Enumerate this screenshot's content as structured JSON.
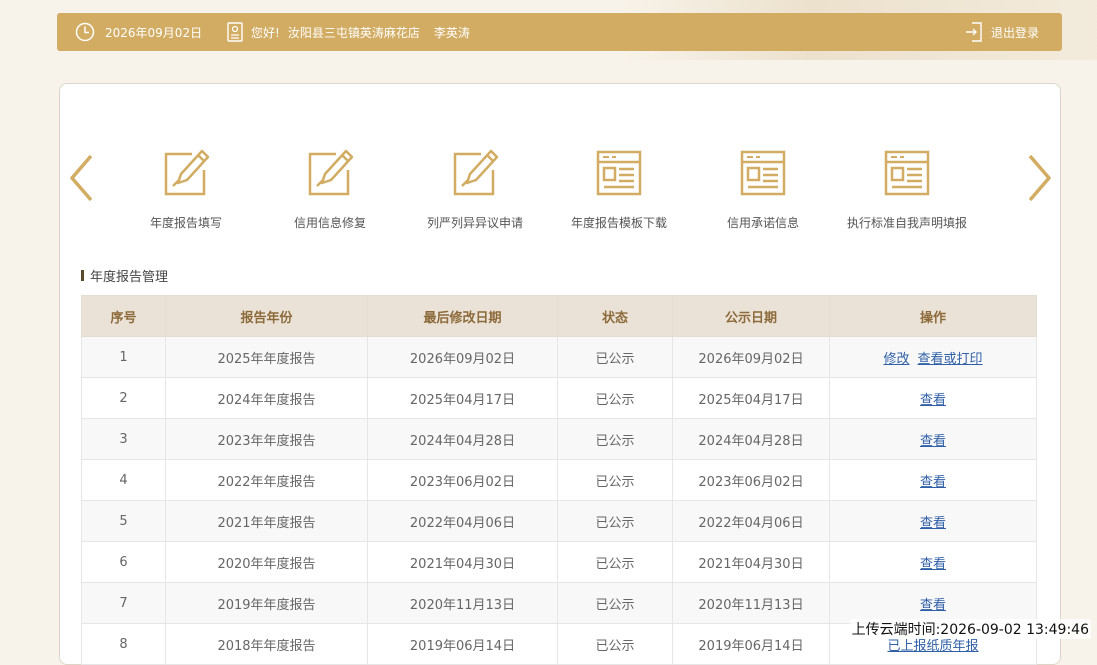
{
  "topbar": {
    "date": "2026年09月02日",
    "greeting": "您好!",
    "shop": "汝阳县三屯镇英涛麻花店",
    "person": "李英涛",
    "logout": "退出登录"
  },
  "services": [
    {
      "label": "年度报告填写",
      "icon": "edit-icon"
    },
    {
      "label": "信用信息修复",
      "icon": "edit-icon"
    },
    {
      "label": "列严列异异议申请",
      "icon": "edit-icon"
    },
    {
      "label": "年度报告模板下载",
      "icon": "document-icon"
    },
    {
      "label": "信用承诺信息",
      "icon": "document-icon"
    },
    {
      "label": "执行标准自我声明填报",
      "icon": "document-icon"
    }
  ],
  "section_title": "年度报告管理",
  "table": {
    "headers": [
      "序号",
      "报告年份",
      "最后修改日期",
      "状态",
      "公示日期",
      "操作"
    ],
    "rows": [
      {
        "no": "1",
        "year": "2025年年度报告",
        "modified": "2026年09月02日",
        "status": "已公示",
        "published": "2026年09月02日",
        "actions": [
          "修改",
          "查看或打印"
        ]
      },
      {
        "no": "2",
        "year": "2024年年度报告",
        "modified": "2025年04月17日",
        "status": "已公示",
        "published": "2025年04月17日",
        "actions": [
          "查看"
        ]
      },
      {
        "no": "3",
        "year": "2023年年度报告",
        "modified": "2024年04月28日",
        "status": "已公示",
        "published": "2024年04月28日",
        "actions": [
          "查看"
        ]
      },
      {
        "no": "4",
        "year": "2022年年度报告",
        "modified": "2023年06月02日",
        "status": "已公示",
        "published": "2023年06月02日",
        "actions": [
          "查看"
        ]
      },
      {
        "no": "5",
        "year": "2021年年度报告",
        "modified": "2022年04月06日",
        "status": "已公示",
        "published": "2022年04月06日",
        "actions": [
          "查看"
        ]
      },
      {
        "no": "6",
        "year": "2020年年度报告",
        "modified": "2021年04月30日",
        "status": "已公示",
        "published": "2021年04月30日",
        "actions": [
          "查看"
        ]
      },
      {
        "no": "7",
        "year": "2019年年度报告",
        "modified": "2020年11月13日",
        "status": "已公示",
        "published": "2020年11月13日",
        "actions": [
          "查看"
        ]
      },
      {
        "no": "8",
        "year": "2018年年度报告",
        "modified": "2019年06月14日",
        "status": "已公示",
        "published": "2019年06月14日",
        "actions": [
          "已上报纸质年报"
        ]
      }
    ]
  },
  "overlay_text": "上传云端时间:2026-09-02 13:49:46",
  "colors": {
    "accent": "#d2ac62",
    "header_bg": "#ebe2d7",
    "link": "#2f5fa7"
  }
}
